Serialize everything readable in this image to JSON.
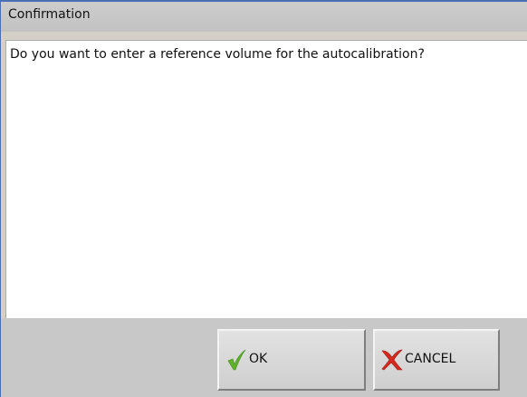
{
  "window": {
    "title": "Confirmation"
  },
  "message": {
    "text": "Do you want to enter a reference volume for the autocalibration?"
  },
  "buttons": {
    "ok": {
      "label": "OK",
      "icon": "checkmark-icon",
      "icon_color": "#5fb22a"
    },
    "cancel": {
      "label": "CANCEL",
      "icon": "x-icon",
      "icon_color": "#d42a1e"
    }
  },
  "colors": {
    "title_accent": "#4b6fb0",
    "background": "#c8c8c8"
  }
}
